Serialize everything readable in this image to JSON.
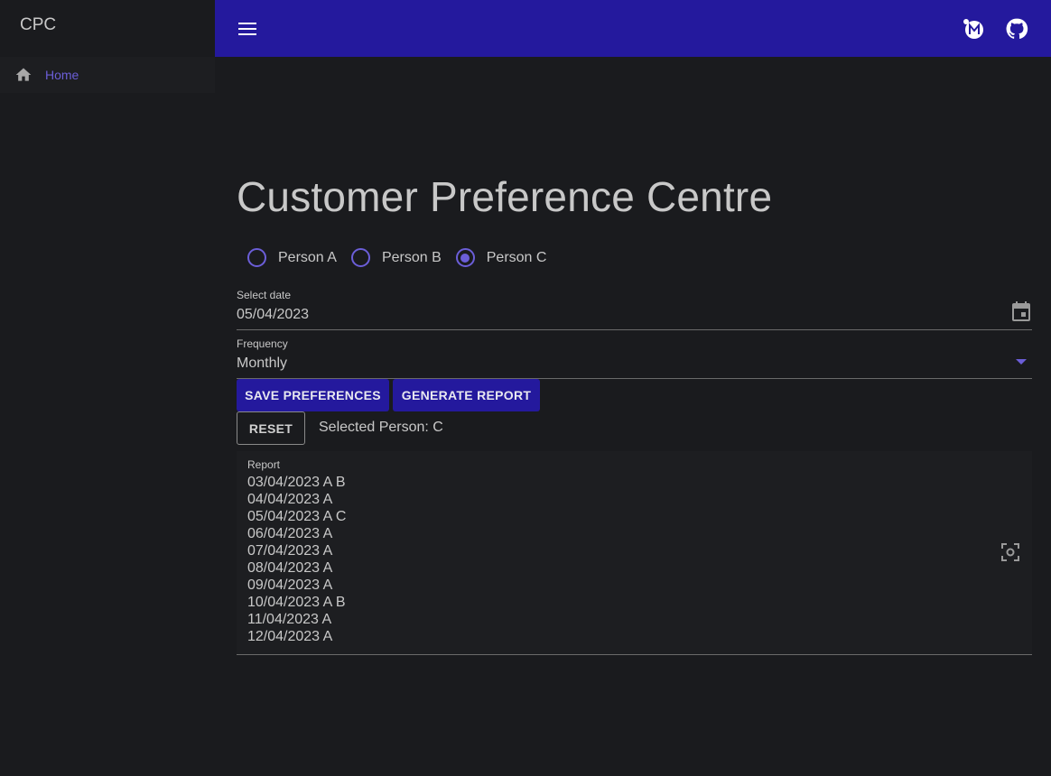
{
  "drawer": {
    "title": "CPC",
    "items": [
      {
        "label": "Home",
        "icon": "home-icon"
      }
    ]
  },
  "appbar": {
    "icons": [
      "menu-icon",
      "mui-logo-icon",
      "github-icon"
    ]
  },
  "main": {
    "title": "Customer Preference Centre",
    "persons": [
      {
        "label": "Person A",
        "checked": false
      },
      {
        "label": "Person B",
        "checked": false
      },
      {
        "label": "Person C",
        "checked": true
      }
    ],
    "date_field": {
      "label": "Select date",
      "value": "05/04/2023",
      "icon": "calendar-icon"
    },
    "frequency_field": {
      "label": "Frequency",
      "value": "Monthly",
      "icon": "dropdown-arrow-icon"
    },
    "buttons": {
      "save": "SAVE PREFERENCES",
      "generate": "GENERATE REPORT",
      "reset": "RESET"
    },
    "selected_person": "Selected Person: C",
    "report": {
      "label": "Report",
      "lines": [
        "03/04/2023 A B",
        "04/04/2023 A",
        "05/04/2023 A C",
        "06/04/2023 A",
        "07/04/2023 A",
        "08/04/2023 A",
        "09/04/2023 A",
        "10/04/2023 A B",
        "11/04/2023 A",
        "12/04/2023 A"
      ]
    }
  },
  "colors": {
    "appbar": "#24199d",
    "accent": "#6b5ed8",
    "background": "#1a1b1e"
  }
}
